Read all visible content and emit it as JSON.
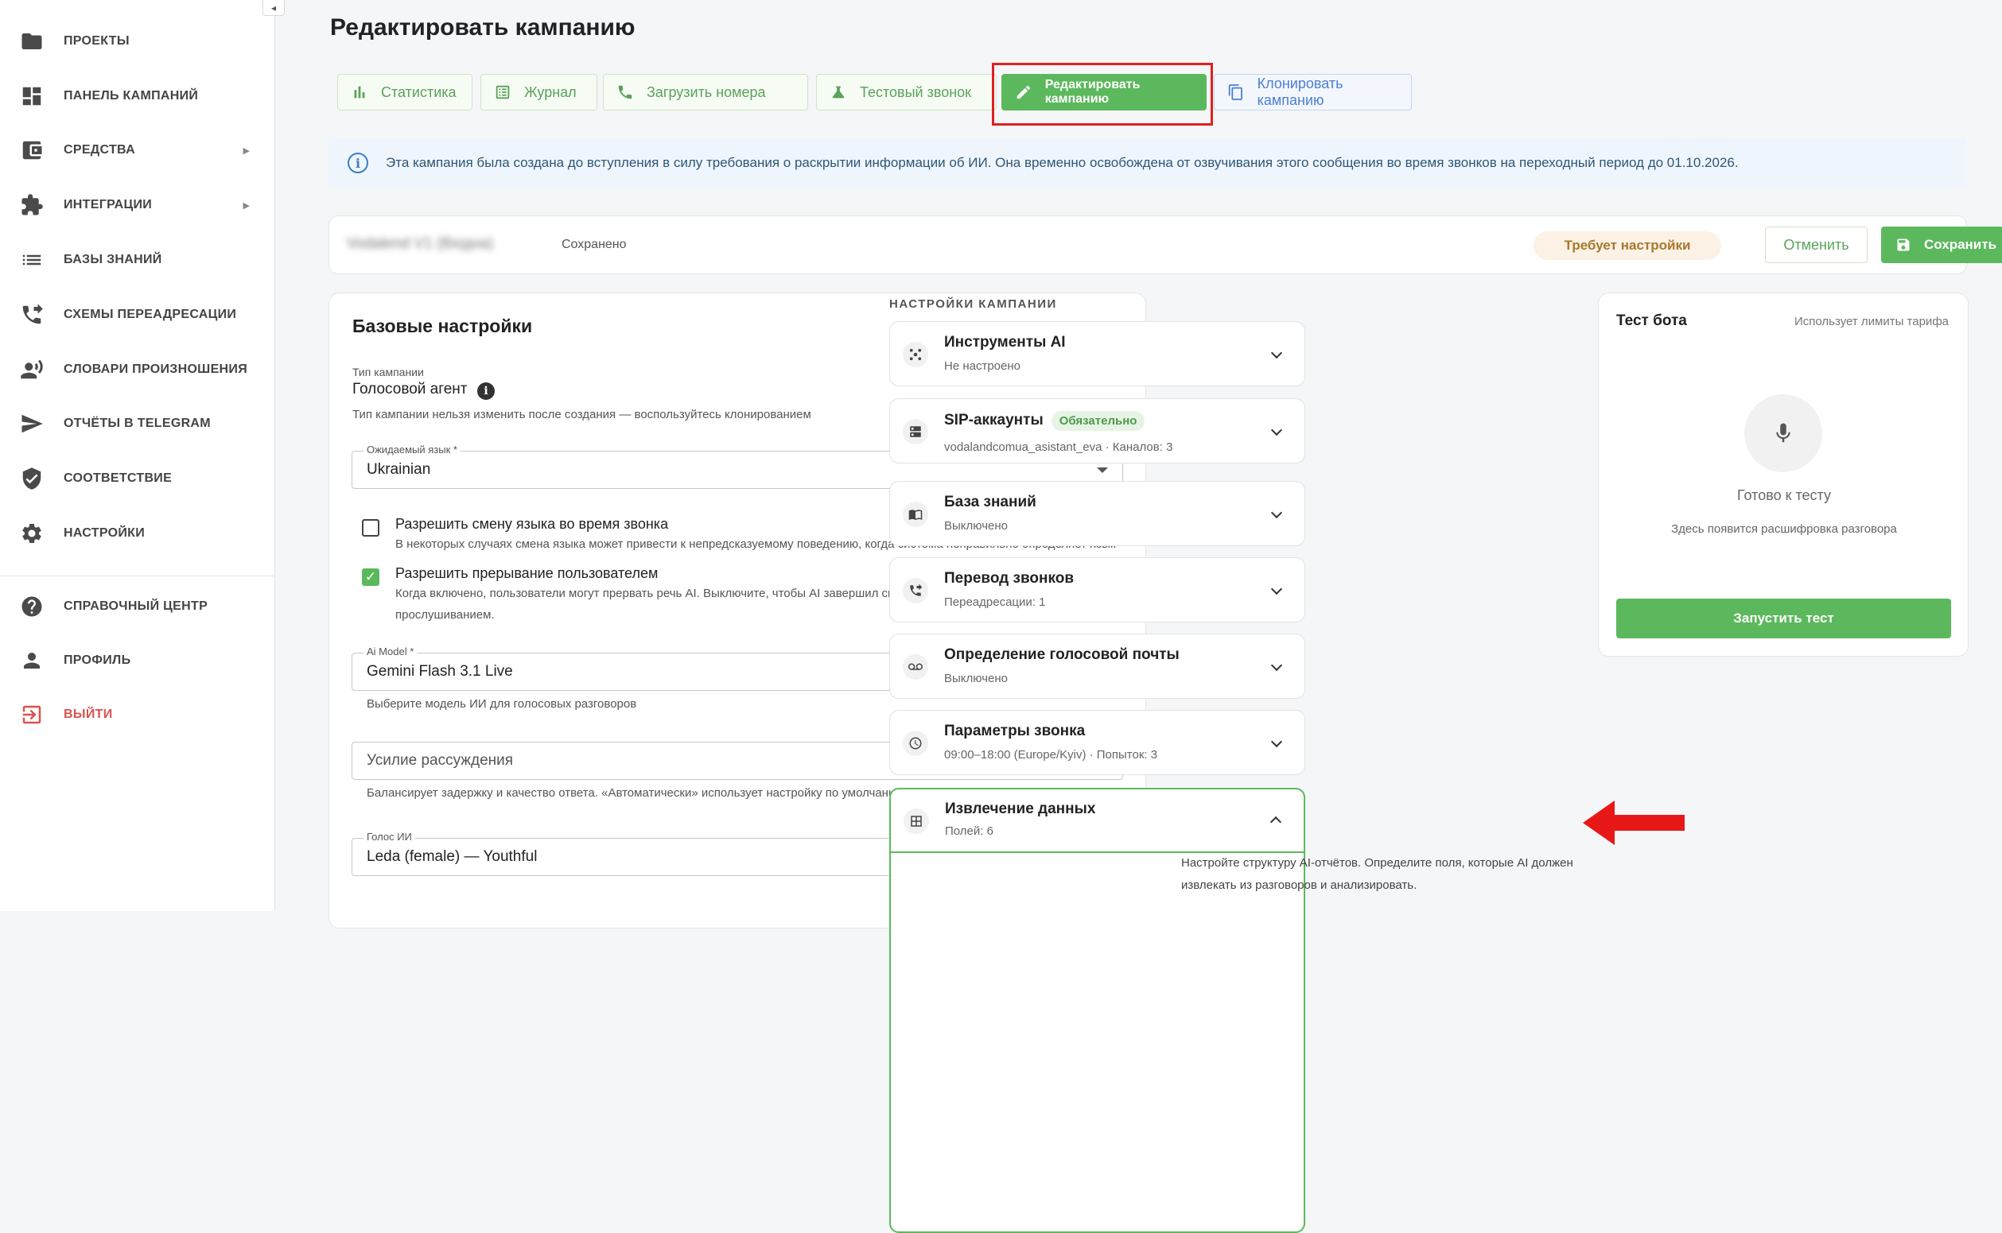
{
  "sidebar": {
    "items": [
      {
        "label": "ПРОЕКТЫ",
        "icon": "folder-icon"
      },
      {
        "label": "ПАНЕЛЬ КАМПАНИЙ",
        "icon": "dashboard-icon"
      },
      {
        "label": "СРЕДСТВА",
        "icon": "wallet-icon"
      },
      {
        "label": "ИНТЕГРАЦИИ",
        "icon": "puzzle-icon"
      },
      {
        "label": "БАЗЫ ЗНАНИЙ",
        "icon": "list-icon"
      },
      {
        "label": "СХЕМЫ ПЕРЕАДРЕСАЦИИ",
        "icon": "phone-forward-icon"
      },
      {
        "label": "СЛОВАРИ ПРОИЗНОШЕНИЯ",
        "icon": "voice-icon"
      },
      {
        "label": "ОТЧЁТЫ В TELEGRAM",
        "icon": "send-icon"
      },
      {
        "label": "СООТВЕТСТВИЕ",
        "icon": "shield-icon"
      },
      {
        "label": "НАСТРОЙКИ",
        "icon": "gear-icon"
      },
      {
        "label": "СПРАВОЧНЫЙ ЦЕНТР",
        "icon": "help-icon"
      },
      {
        "label": "ПРОФИЛЬ",
        "icon": "person-icon"
      },
      {
        "label": "ВЫЙТИ",
        "icon": "logout-icon"
      }
    ]
  },
  "header": {
    "title": "Редактировать кампанию"
  },
  "tabs": [
    {
      "label": "Статистика",
      "icon": "bar-chart-icon"
    },
    {
      "label": "Журнал",
      "icon": "journal-icon"
    },
    {
      "label": "Загрузить номера",
      "icon": "phone-icon"
    },
    {
      "label": "Тестовый звонок",
      "icon": "flask-icon"
    },
    {
      "label": "Редактировать кампанию",
      "icon": "pencil-icon"
    },
    {
      "label": "Клонировать кампанию",
      "icon": "copy-icon"
    }
  ],
  "banner": {
    "text": "Эта кампания была создана до вступления в силу требования о раскрытии информации об ИИ. Она временно освобождена от озвучивания этого сообщения во время звонков на переходный период до 01.10.2026."
  },
  "campaign_bar": {
    "name": "Vodalend V1 (Вхідна)",
    "status": "Сохранено",
    "badge": "Требует настройки",
    "cancel": "Отменить",
    "save": "Сохранить"
  },
  "base": {
    "title": "Базовые настройки",
    "type_label": "Тип кампании",
    "type_value": "Голосовой агент",
    "type_help": "Тип кампании нельзя изменить после создания — воспользуйтесь клонированием",
    "lang_label": "Ожидаемый язык *",
    "lang_value": "Ukrainian",
    "switch_lang_label": "Разрешить смену языка во время звонка",
    "switch_lang_help": "В некоторых случаях смена языка может привести к непредсказуемому поведению, когда система неправильно определяет язык",
    "interrupt_label": "Разрешить прерывание пользователем",
    "interrupt_help_1": "Когда включено, пользователи могут прервать речь AI. Выключите, чтобы AI завершил своё сообщение перед",
    "interrupt_help_2": "прослушиванием.",
    "model_label": "Ai Model *",
    "model_value": "Gemini Flash 3.1 Live",
    "model_help": "Выберите модель ИИ для голосовых разговоров",
    "reasoning_placeholder": "Усилие рассуждения",
    "reasoning_help": "Балансирует задержку и качество ответа. «Автоматически» использует настройку по умолчанию.",
    "voice_label": "Голос ИИ",
    "voice_value": "Leda (female) — Youthful"
  },
  "settings": {
    "heading": "НАСТРОЙКИ КАМПАНИИ",
    "items": [
      {
        "title": "Инструменты AI",
        "sub": "Не настроено",
        "icon": "tools-icon"
      },
      {
        "title": "SIP-аккаунты",
        "badge": "Обязательно",
        "sub": "vodalandcomua_asistant_eva · Каналов: 3",
        "icon": "server-icon"
      },
      {
        "title": "База знаний",
        "sub": "Выключено",
        "icon": "book-icon"
      },
      {
        "title": "Перевод звонков",
        "sub": "Переадресации: 1",
        "icon": "phone-forward-icon"
      },
      {
        "title": "Определение голосовой почты",
        "sub": "Выключено",
        "icon": "voicemail-icon"
      },
      {
        "title": "Параметры звонка",
        "sub": "09:00–18:00 (Europe/Kyiv) · Попыток: 3",
        "icon": "clock-icon"
      },
      {
        "title": "Извлечение данных",
        "sub": "Полей: 6",
        "icon": "table-icon"
      }
    ],
    "extract_desc_1": "Настройте структуру AI-отчётов. Определите поля, которые AI должен",
    "extract_desc_2": "извлекать из разговоров и анализировать."
  },
  "test": {
    "title": "Тест бота",
    "limit": "Использует лимиты тарифа",
    "ready": "Готово к тесту",
    "transcript": "Здесь появится расшифровка разговора",
    "run": "Запустить тест"
  },
  "colors": {
    "accent": "#5cb85c",
    "highlight": "#e02020"
  }
}
